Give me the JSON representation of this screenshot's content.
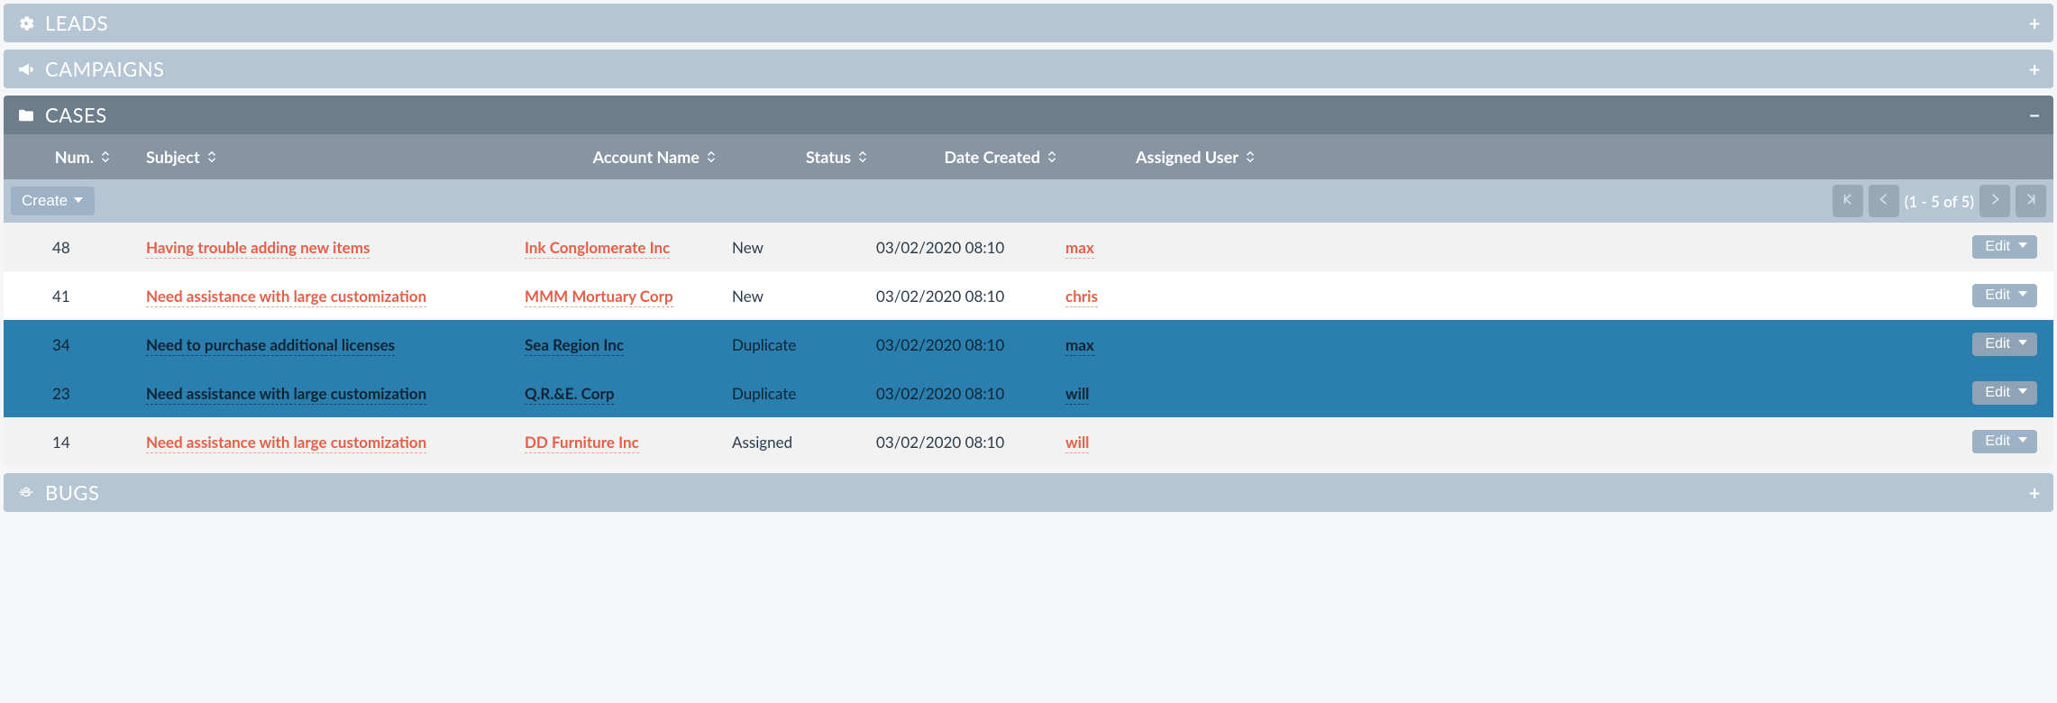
{
  "panels": {
    "leads": {
      "title": "LEADS",
      "expanded": false
    },
    "campaigns": {
      "title": "CAMPAIGNS",
      "expanded": false
    },
    "cases": {
      "title": "CASES",
      "expanded": true
    },
    "bugs": {
      "title": "BUGS",
      "expanded": false
    }
  },
  "cases": {
    "columns": {
      "num": "Num.",
      "subject": "Subject",
      "account": "Account Name",
      "status": "Status",
      "date": "Date Created",
      "user": "Assigned User"
    },
    "create_label": "Create",
    "edit_label": "Edit",
    "pager_text": "(1 - 5 of 5)",
    "rows": [
      {
        "num": "48",
        "subject": "Having trouble adding new items",
        "account": "Ink Conglomerate Inc",
        "status": "New",
        "date": "03/02/2020 08:10",
        "user": "max",
        "selected": false
      },
      {
        "num": "41",
        "subject": "Need assistance with large customization",
        "account": "MMM Mortuary Corp",
        "status": "New",
        "date": "03/02/2020 08:10",
        "user": "chris",
        "selected": false
      },
      {
        "num": "34",
        "subject": "Need to purchase additional licenses",
        "account": "Sea Region Inc",
        "status": "Duplicate",
        "date": "03/02/2020 08:10",
        "user": "max",
        "selected": true
      },
      {
        "num": "23",
        "subject": "Need assistance with large customization",
        "account": "Q.R.&E. Corp",
        "status": "Duplicate",
        "date": "03/02/2020 08:10",
        "user": "will",
        "selected": true
      },
      {
        "num": "14",
        "subject": "Need assistance with large customization",
        "account": "DD Furniture Inc",
        "status": "Assigned",
        "date": "03/02/2020 08:10",
        "user": "will",
        "selected": false
      }
    ]
  }
}
